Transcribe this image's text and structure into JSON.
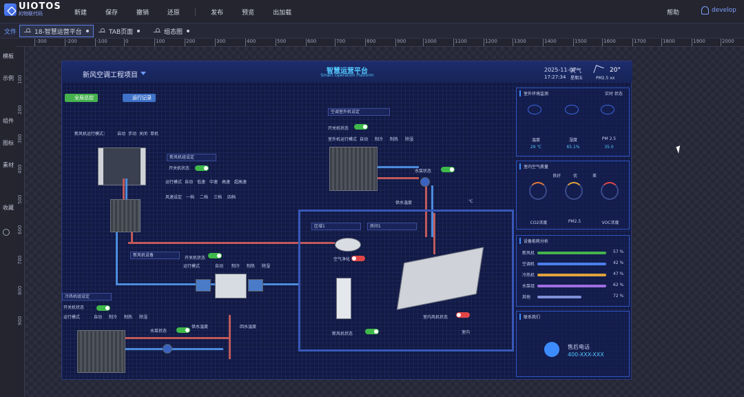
{
  "app": {
    "logo_name": "UIOTOS",
    "logo_sub": "的物联代码"
  },
  "menu": {
    "items": [
      "新建",
      "保存",
      "撤销",
      "还原",
      "发布",
      "预览",
      "出加载"
    ],
    "help": "帮助",
    "user": "develop"
  },
  "tabs": {
    "file_label": "文件",
    "items": [
      "18-智慧运营平台",
      "TAB页面",
      "组态图"
    ]
  },
  "leftnav": [
    "模板",
    "示例",
    "组件",
    "图标",
    "素材",
    "收藏"
  ],
  "ruler_h": [
    "-300",
    "-200",
    "-100",
    "0",
    "100",
    "200",
    "300",
    "400",
    "500",
    "600",
    "700",
    "800",
    "900",
    "1000",
    "1100",
    "1200",
    "1300",
    "1400",
    "1500",
    "1600",
    "1700",
    "1800",
    "1900",
    "2000"
  ],
  "ruler_v": [
    "100",
    "200",
    "300",
    "400",
    "500",
    "600",
    "700",
    "800",
    "900"
  ],
  "screen": {
    "project": "新风空调工程项目",
    "title": "智慧运营平台",
    "title_en": "Smart Operation Platform",
    "date": "2025-11-07",
    "time": "17:27:34",
    "weekday": "星期五",
    "weather": "天气",
    "temp": "20°",
    "pm": "PM2.5 xx",
    "btn_global": "全局总控",
    "btn_alarm": "运行记录",
    "mode_row": "新风机运行模式：",
    "mode_opts": [
      "自动",
      "手动",
      "关闭",
      "单机"
    ],
    "dropdown_left": "新风机组设定",
    "switch_label": "开关机状态",
    "fan_label": "运行模式",
    "fan_opts": [
      "自动",
      "低速",
      "中速",
      "高速",
      "超高速"
    ],
    "speed_label": "风速设定",
    "speed_opts": [
      "一档",
      "二档",
      "三档",
      "四档"
    ],
    "dropdown_mid": "新风机设备",
    "mid_switch": "开关机状态",
    "mid_mode": "运行模式",
    "mid_opts": [
      "自动",
      "制冷",
      "制热",
      "除湿"
    ],
    "top_dropdown": "空调室外机设定",
    "top_switch": "开关机状态",
    "top_mode": "室外机运行模式",
    "top_opts": [
      "自动",
      "制冷",
      "制热",
      "除湿"
    ],
    "pump_label": "水泵状态",
    "water_temp": "供水温度",
    "water_unit": "℃",
    "outdoor_dd": "冷热机组设定",
    "outdoor_switch": "开关机状态",
    "outdoor_mode": "运行模式",
    "outdoor_opts": [
      "自动",
      "制冷",
      "制热",
      "除湿"
    ],
    "pump2": "水泵状态",
    "supply": "供水温度",
    "return": "回水温度",
    "room_dd1": "区域1",
    "room_dd2": "房间1",
    "purifier": "空气净化",
    "ac_status": "新风机状态",
    "cassette": "室内风机状态",
    "room_label": "室内"
  },
  "panels": {
    "env": {
      "title": "室外环境监测",
      "right": "实时 状态",
      "labels": [
        "温度",
        "湿度",
        "PM 2.5"
      ],
      "values": [
        "29 ℃",
        "65.1%",
        "35.0"
      ]
    },
    "air": {
      "title": "室内空气质量",
      "labels": [
        "CO2浓度",
        "PM2.5",
        "VOC浓度"
      ],
      "legend": [
        "良好",
        "优",
        "差"
      ]
    },
    "energy": {
      "title": "设备能耗分析",
      "rows": [
        "新风机",
        "空调机",
        "冷热机",
        "水泵组",
        "其他"
      ],
      "pct": [
        "57 %",
        "42 %",
        "47 %",
        "62 %",
        "72 %"
      ]
    },
    "contact": {
      "title": "联系我们",
      "label": "售后电话",
      "number": "400-XXX-XXX"
    }
  },
  "colors": {
    "accent": "#3d8cff",
    "title": "#53c8ff",
    "ok": "#3fb94a",
    "off": "#e04646",
    "screen": "#121a44"
  }
}
